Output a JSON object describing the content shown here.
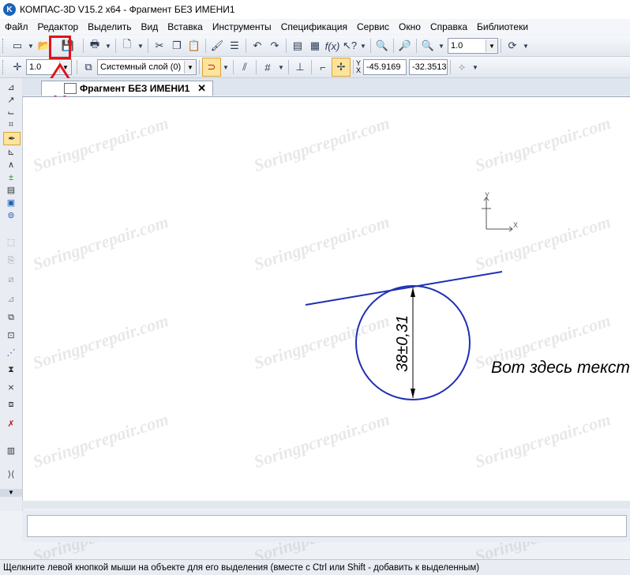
{
  "window": {
    "app_icon": "K",
    "title": "КОМПАС-3D V15.2  x64 - Фрагмент БЕЗ ИМЕНИ1"
  },
  "menu": [
    "Файл",
    "Редактор",
    "Выделить",
    "Вид",
    "Вставка",
    "Инструменты",
    "Спецификация",
    "Сервис",
    "Окно",
    "Справка",
    "Библиотеки"
  ],
  "toolbar1": {
    "zoom_value": "1.0"
  },
  "toolbar2": {
    "step_value": "1.0",
    "layer_value": "Системный слой (0)",
    "x_label": "X",
    "y_label": "Y",
    "coord_x": "-45.9169",
    "coord_y": "-32.3513"
  },
  "tab": {
    "label": "Фрагмент БЕЗ ИМЕНИ1",
    "close": "✕"
  },
  "drawing": {
    "dimension_text": "38±0,31",
    "note_text": "Вот здесь текст",
    "axis_x": "X",
    "axis_y": "Y"
  },
  "watermark": "Soringpcrepair.com",
  "status": {
    "text": "Щелкните левой кнопкой мыши на объекте для его выделения (вместе с Ctrl или Shift - добавить к выделенным)"
  },
  "colors": {
    "highlight": "#e3121b",
    "geometry": "#1f2fb4"
  }
}
